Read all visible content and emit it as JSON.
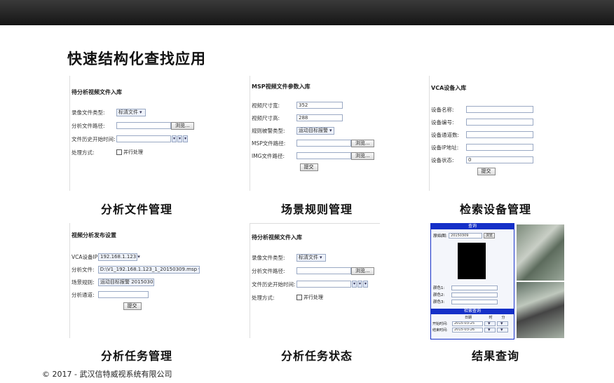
{
  "heading": "快速结构化查找应用",
  "footer": "© 2017 - 武汉信特威视系统有限公司",
  "panels": {
    "analysis_file": {
      "title": "待分析视频文件入库",
      "caption": "分析文件管理",
      "rows": [
        {
          "label": "录像文件类型:",
          "value": "标清文件"
        },
        {
          "label": "分析文件路径:",
          "value": "",
          "button": "浏览..."
        },
        {
          "label": "文件历史开始时间:",
          "value": ""
        },
        {
          "label": "处理方式:",
          "check": "并行处理"
        }
      ]
    },
    "scene_rule": {
      "title": "MSP视频文件参数入库",
      "caption": "场景规则管理",
      "rows": [
        {
          "label": "视频尺寸宽:",
          "value": "352"
        },
        {
          "label": "视频尺寸高:",
          "value": "288"
        },
        {
          "label": "规则被警类型:",
          "value": "运动目标报警"
        },
        {
          "label": "MSP文件路径:",
          "value": "",
          "button": "浏览..."
        },
        {
          "label": "IMG文件路径:",
          "value": "",
          "button": "浏览..."
        }
      ],
      "submit": "提交"
    },
    "retrieval_device": {
      "title": "VCA设备入库",
      "caption": "检索设备管理",
      "rows": [
        {
          "label": "设备名称:",
          "value": ""
        },
        {
          "label": "设备编号:",
          "value": ""
        },
        {
          "label": "设备通道数:",
          "value": ""
        },
        {
          "label": "设备IP地址:",
          "value": ""
        },
        {
          "label": "设备状态:",
          "value": "0"
        }
      ],
      "submit": "提交"
    },
    "analysis_task": {
      "title": "视频分析发布设置",
      "caption": "分析任务管理",
      "rows": [
        {
          "label": "VCA设备IP:",
          "value": "192.168.1.123"
        },
        {
          "label": "分析文件:",
          "value": "D:\\V1_192.168.1.123_1_20150309.msp"
        },
        {
          "label": "场景规则:",
          "value": "运动目标报警 20150305"
        },
        {
          "label": "分析通道:",
          "value": ""
        }
      ],
      "submit": "提交"
    },
    "analysis_status": {
      "title": "待分析视频文件入库",
      "caption": "分析任务状态",
      "rows": [
        {
          "label": "录像文件类型:",
          "value": "标清文件"
        },
        {
          "label": "分析文件路径:",
          "value": "",
          "button": "浏览..."
        },
        {
          "label": "文件历史开始时间:",
          "value": ""
        },
        {
          "label": "处理方式:",
          "check": "并行处理"
        }
      ]
    },
    "result_query": {
      "caption": "结果查询",
      "header1": "查询",
      "header2": "检索查询",
      "query_label": "原始图:",
      "query_value": "20150309",
      "query_button": "浏览",
      "attr_labels": [
        "颜色1:",
        "颜色2:",
        "颜色3:"
      ],
      "col_headers": [
        "日期",
        "时",
        "分"
      ],
      "time_rows": [
        {
          "label": "开始时间:",
          "date": "2015-03-25"
        },
        {
          "label": "结束时间:",
          "date": "2015-03-26"
        }
      ]
    }
  }
}
